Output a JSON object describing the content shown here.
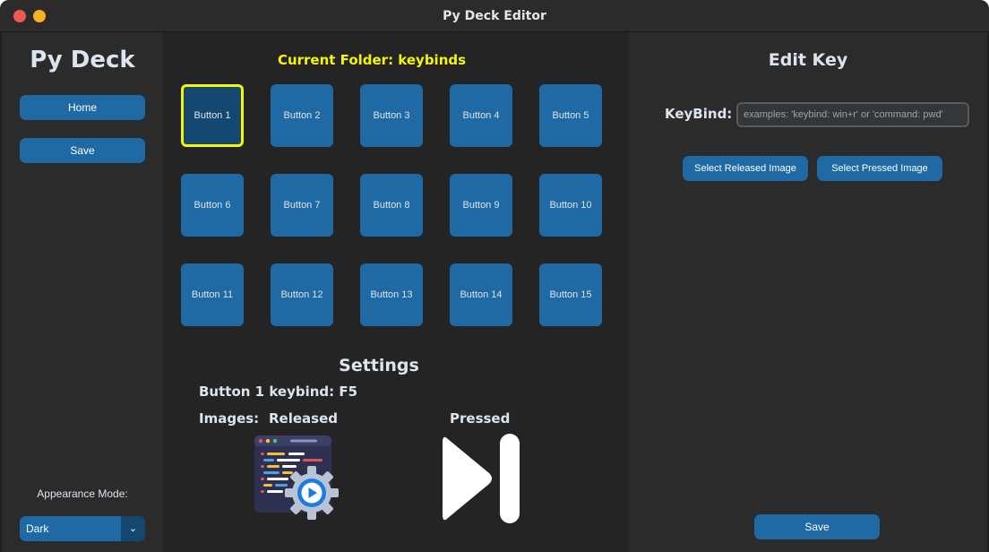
{
  "window": {
    "title": "Py Deck Editor"
  },
  "sidebar": {
    "logo": "Py Deck",
    "home_label": "Home",
    "save_label": "Save",
    "appearance_label": "Appearance Mode:",
    "appearance_value": "Dark"
  },
  "main": {
    "folder_title": "Current Folder: keybinds",
    "selected_key": "Button 1",
    "keys": [
      "Button 1",
      "Button 2",
      "Button 3",
      "Button 4",
      "Button 5",
      "Button 6",
      "Button 7",
      "Button 8",
      "Button 9",
      "Button 10",
      "Button 11",
      "Button 12",
      "Button 13",
      "Button 14",
      "Button 15"
    ],
    "settings": {
      "title": "Settings",
      "keybind_info": "Button 1 keybind: F5",
      "images_label": "Images:",
      "released_label": "Released",
      "pressed_label": "Pressed",
      "released_image_icon": "code-playback-gear-icon",
      "pressed_image_icon": "play-pause-icon"
    }
  },
  "edit": {
    "title": "Edit Key",
    "keybind_label": "KeyBind:",
    "keybind_placeholder": "examples: 'keybind: win+r' or 'command: pwd'",
    "keybind_value": "",
    "select_released_label": "Select Released Image",
    "select_pressed_label": "Select Pressed Image",
    "save_label": "Save"
  },
  "colors": {
    "accent": "#1f6aa5",
    "accent_dark": "#144870",
    "highlight": "#f5f50a",
    "background": "#242424",
    "panel": "#2b2b2b",
    "text": "#dce4ee"
  }
}
